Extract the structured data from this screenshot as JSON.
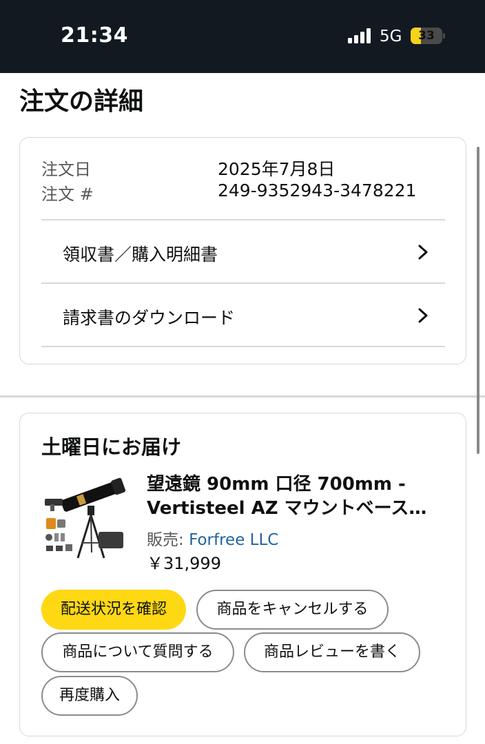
{
  "status_bar": {
    "time": "21:34",
    "network": "5G",
    "battery": "33",
    "battery_level": 0.33
  },
  "page_title": "注文の詳細",
  "order": {
    "date_label": "注文日",
    "date_value": "2025年7月8日",
    "number_label": "注文 #",
    "number_value": "249-9352943-3478221",
    "links": [
      {
        "label": "領収書／購入明細書"
      },
      {
        "label": "請求書のダウンロード"
      }
    ]
  },
  "shipment": {
    "title": "土曜日にお届け",
    "product": {
      "title_line1": "望遠鏡 90mm 口径 700mm -",
      "title_line2": "Vertisteel AZ マウントベース…",
      "seller_prefix": "販売: ",
      "seller_name": "Forfree LLC",
      "price": "￥31,999"
    },
    "buttons": {
      "track": "配送状況を確認",
      "cancel": "商品をキャンセルする",
      "question": "商品について質問する",
      "review": "商品レビューを書く",
      "buy_again": "再度購入"
    }
  },
  "colors": {
    "header_bg": "#131921",
    "primary_button": "#ffd814",
    "link": "#2162a1",
    "border": "#d5d9d9"
  }
}
